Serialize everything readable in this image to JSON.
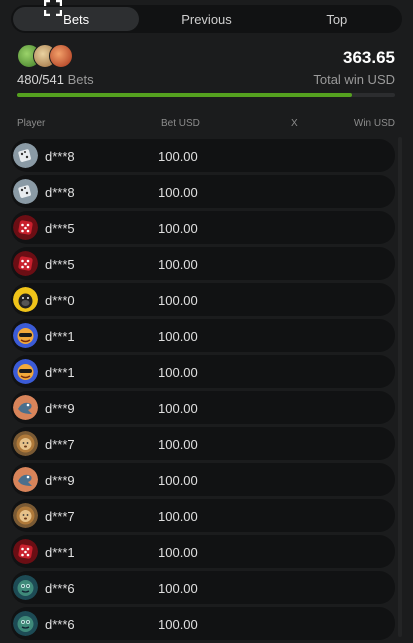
{
  "tabs": [
    "Bets",
    "Previous",
    "Top"
  ],
  "summary": {
    "bets_count": "480/541",
    "bets_label": "Bets",
    "total_win": "363.65",
    "total_win_label": "Total win USD",
    "progress_fraction": 0.887,
    "top_avatars": [
      "avatar-green",
      "avatar-tan",
      "avatar-red"
    ]
  },
  "columns": {
    "player": "Player",
    "bet": "Bet USD",
    "mult": "X",
    "win": "Win USD"
  },
  "accent": {
    "progress": "#55a11f"
  },
  "rows": [
    {
      "player": "d***8",
      "bet": "100.00",
      "mult": "",
      "win": "",
      "avatar": "dice-white-icon"
    },
    {
      "player": "d***8",
      "bet": "100.00",
      "mult": "",
      "win": "",
      "avatar": "dice-white-icon"
    },
    {
      "player": "d***5",
      "bet": "100.00",
      "mult": "",
      "win": "",
      "avatar": "dice-red-icon"
    },
    {
      "player": "d***5",
      "bet": "100.00",
      "mult": "",
      "win": "",
      "avatar": "dice-red-icon"
    },
    {
      "player": "d***0",
      "bet": "100.00",
      "mult": "",
      "win": "",
      "avatar": "gorilla-icon"
    },
    {
      "player": "d***1",
      "bet": "100.00",
      "mult": "",
      "win": "",
      "avatar": "cool-face-icon"
    },
    {
      "player": "d***1",
      "bet": "100.00",
      "mult": "",
      "win": "",
      "avatar": "cool-face-icon"
    },
    {
      "player": "d***9",
      "bet": "100.00",
      "mult": "",
      "win": "",
      "avatar": "blue-bird-icon"
    },
    {
      "player": "d***7",
      "bet": "100.00",
      "mult": "",
      "win": "",
      "avatar": "lion-icon"
    },
    {
      "player": "d***9",
      "bet": "100.00",
      "mult": "",
      "win": "",
      "avatar": "blue-bird-icon"
    },
    {
      "player": "d***7",
      "bet": "100.00",
      "mult": "",
      "win": "",
      "avatar": "lion-icon"
    },
    {
      "player": "d***1",
      "bet": "100.00",
      "mult": "",
      "win": "",
      "avatar": "dice-red-icon"
    },
    {
      "player": "d***6",
      "bet": "100.00",
      "mult": "",
      "win": "",
      "avatar": "green-creature-icon"
    },
    {
      "player": "d***6",
      "bet": "100.00",
      "mult": "",
      "win": "",
      "avatar": "green-creature-icon"
    }
  ]
}
